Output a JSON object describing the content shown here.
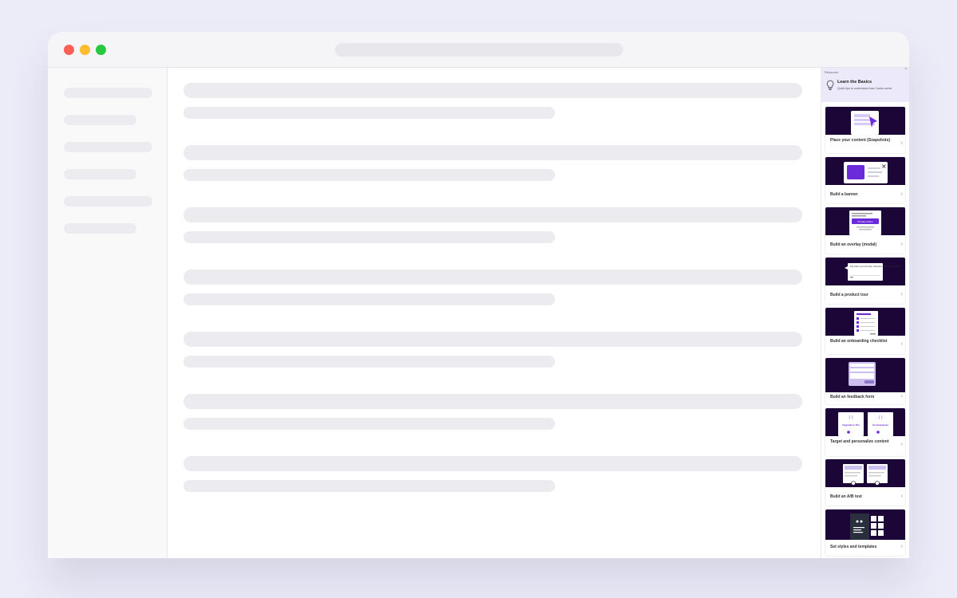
{
  "panel": {
    "kicker": "Resource",
    "close": "×",
    "title": "Learn the Basics",
    "subtitle": "Quick tips to understand how Candu works",
    "chevron": "›",
    "cards": [
      {
        "label": "Place your content (Snapshots)"
      },
      {
        "label": "Build a banner"
      },
      {
        "label": "Build an overlay (modal)"
      },
      {
        "label": "Build a product tour"
      },
      {
        "label": "Build an onboarding checklist"
      },
      {
        "label": "Build an feedback form"
      },
      {
        "label": "Target and personalize content"
      },
      {
        "label": "Build an A/B test"
      },
      {
        "label": "Set styles and templates"
      }
    ]
  },
  "thumb_text": {
    "primary_action": "Primary Action",
    "upgrade": "Upgrade to Pro",
    "enterprise": "Go Enterprise",
    "tour_text": "Say hello to your first Step. Add some description for Tours"
  },
  "colors": {
    "accent": "#6b2bd9",
    "thumb_bg": "#1c0537",
    "panel_header": "#eceafa"
  }
}
